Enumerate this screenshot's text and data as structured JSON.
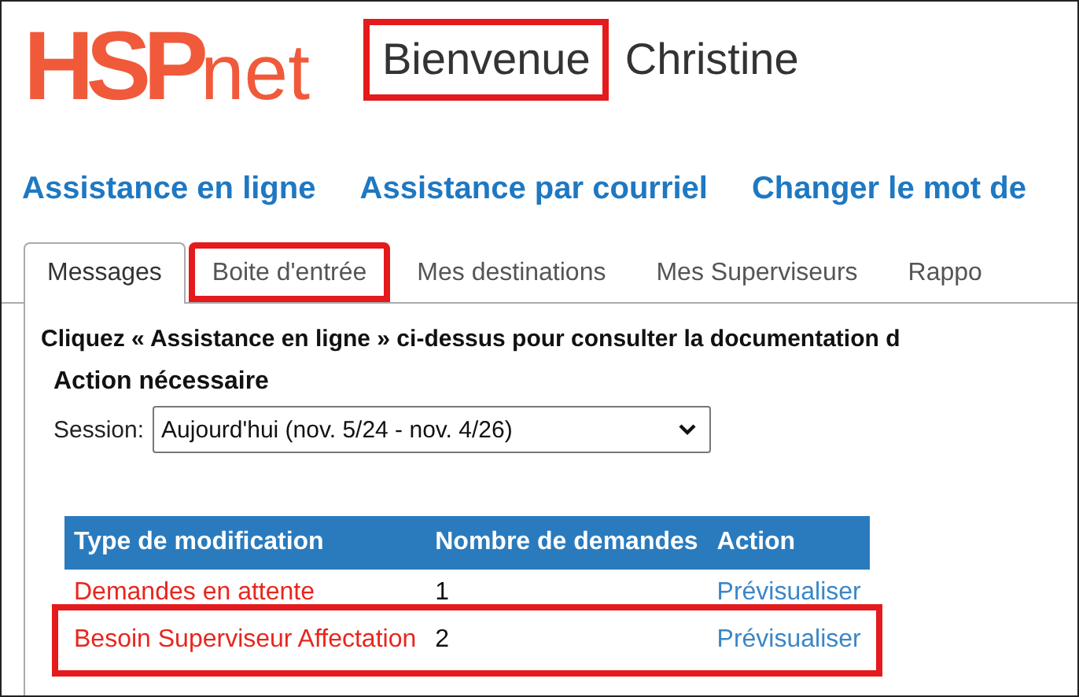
{
  "logo": {
    "strong": "HSP",
    "light": "net"
  },
  "welcome": [
    {
      "text": "Bienvenue",
      "highlighted": true
    },
    {
      "text": "Christine",
      "highlighted": false
    }
  ],
  "links": [
    "Assistance en ligne",
    "Assistance par courriel",
    "Changer le mot de"
  ],
  "tabs": [
    {
      "label": "Messages",
      "selected": true,
      "highlighted": false
    },
    {
      "label": "Boite d'entrée",
      "selected": false,
      "highlighted": true
    },
    {
      "label": "Mes destinations",
      "selected": false,
      "highlighted": false
    },
    {
      "label": "Mes Superviseurs",
      "selected": false,
      "highlighted": false
    },
    {
      "label": "Rappo",
      "selected": false,
      "highlighted": false
    }
  ],
  "notice": "Cliquez « Assistance en ligne » ci-dessus pour consulter la documentation d",
  "section_title": "Action nécessaire",
  "session": {
    "label": "Session:",
    "value": "Aujourd'hui (nov. 5/24 - nov. 4/26)"
  },
  "table": {
    "columns": [
      "Type de modification",
      "Nombre de demandes",
      "Action"
    ],
    "rows": [
      {
        "type": "Demandes en attente",
        "count": "1",
        "action": "Prévisualiser",
        "highlighted": false
      },
      {
        "type": "Besoin Superviseur Affectation",
        "count": "2",
        "action": "Prévisualiser",
        "highlighted": true
      }
    ]
  }
}
